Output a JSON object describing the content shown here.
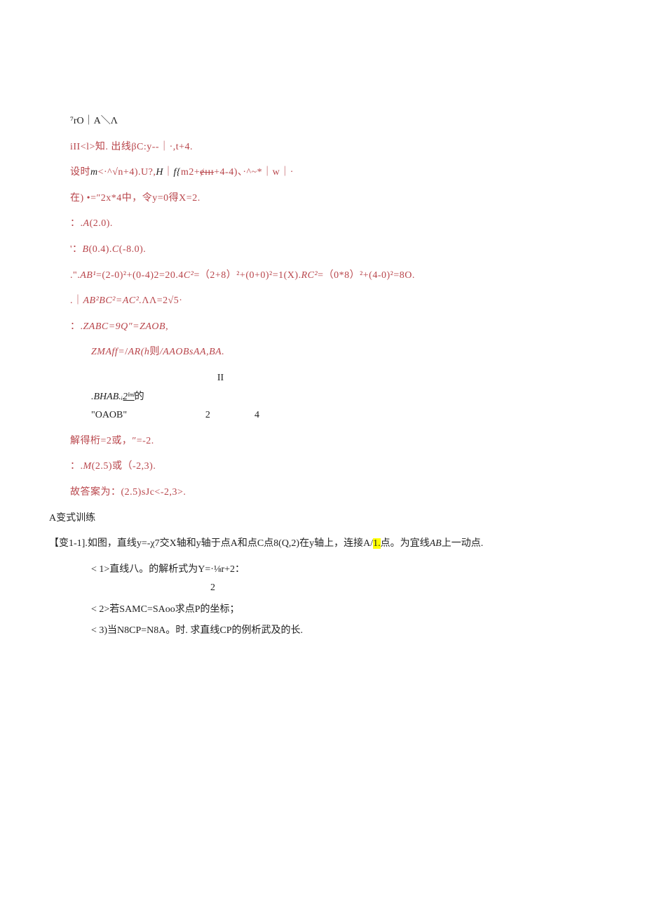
{
  "lines": {
    "l1": "⁷rO｜A＼Λ",
    "l2": "iII<l>知. 出线βC:y--｜·,t+4.",
    "l3": "设时m<·^√n+4).U?,H｜f{m2+ɇɪɪɪ+4-4)、·^~*｜w｜·",
    "l4": "在) •=″2x*4中，令y=0得X=2.",
    "l5": "：.A(2.0).",
    "l6": "'：B(0.4).C(-8.0).",
    "l7": ".\".AB¹=(2-0)²+(0-4)2=20.4C²=（2+8）²+(0+0)²=1(X).RC²=（0*8）²+(4-0)²=8O.",
    "l8": ".｜AB²BC²=AC².ΛΛ=2√5·",
    "l9": "：.ZABC=9Q″=ZAOB,",
    "l10": "ZMAff=/AR(h则/AAOBsAA,BA.",
    "grid_a": ".BHAB.ᵢ2ˡᵐˡ的",
    "grid_b": "II",
    "grid_c": "\"OAOB\"",
    "grid_d": "2",
    "grid_e": "4",
    "l13": "解得桁=2或，″=-2.",
    "l14": "：.M(2.5)或（-2,3).",
    "l15": "故答案为：(2.5)sJc<-2,3>.",
    "l16": "A变式训练",
    "l17a": "【变1-1].如图，直线y=-χ7交X轴和y轴于点A和点C点8(Q,2)在y轴上，连接A/",
    "l17b": "1.",
    "l17c": "点。为宜线AB上一动点.",
    "l18a": "<  1>直线八。的解析式为Y=·⅛r+2：",
    "l18b": "2",
    "l19": "<  2>若SAMC=SAoo求点P的坐标；",
    "l20": "<  3)当N8CP=N8A。时. 求直线CP的例析武及的长."
  }
}
